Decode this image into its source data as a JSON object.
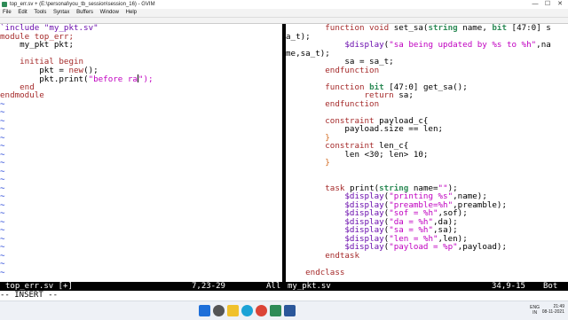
{
  "window": {
    "title": "top_err.sv + (E:\\personal\\you_tb_session\\session_16) - GVIM",
    "controls": [
      "—",
      "☐",
      "✕"
    ]
  },
  "menu": [
    "File",
    "Edit",
    "Tools",
    "Syntax",
    "Buffers",
    "Window",
    "Help"
  ],
  "left_pane": {
    "lines": [
      [
        {
          "t": "`include \"my_pkt.sv\"",
          "c": "k-purple"
        }
      ],
      [
        {
          "t": "module top_err;",
          "c": "k-brown"
        }
      ],
      [
        {
          "t": "    my_pkt pkt;",
          "c": ""
        }
      ],
      [
        {
          "t": "",
          "c": ""
        }
      ],
      [
        {
          "t": "    ",
          "c": ""
        },
        {
          "t": "initial begin",
          "c": "k-brown"
        }
      ],
      [
        {
          "t": "        pkt = ",
          "c": ""
        },
        {
          "t": "new",
          "c": "k-brown"
        },
        {
          "t": "();",
          "c": ""
        }
      ],
      [
        {
          "t": "        pkt.print(",
          "c": ""
        },
        {
          "t": "\"before ra",
          "c": "k-magenta"
        },
        {
          "t": "CURSOR",
          "c": ""
        },
        {
          "t": "\");",
          "c": "k-magenta"
        }
      ],
      [
        {
          "t": "    ",
          "c": ""
        },
        {
          "t": "end",
          "c": "k-brown"
        }
      ],
      [
        {
          "t": "endmodule",
          "c": "k-brown"
        }
      ]
    ],
    "tilde_count": 21
  },
  "right_pane": {
    "lines": [
      [
        {
          "t": "        ",
          "c": ""
        },
        {
          "t": "function void",
          "c": "k-brown"
        },
        {
          "t": " set_sa(",
          "c": ""
        },
        {
          "t": "string",
          "c": "k-green"
        },
        {
          "t": " name, ",
          "c": ""
        },
        {
          "t": "bit",
          "c": "k-green"
        },
        {
          "t": " [47:0] s",
          "c": ""
        }
      ],
      [
        {
          "t": "a_t);",
          "c": ""
        }
      ],
      [
        {
          "t": "            ",
          "c": ""
        },
        {
          "t": "$display",
          "c": "k-purple"
        },
        {
          "t": "(",
          "c": ""
        },
        {
          "t": "\"sa being updated by %s to %h\"",
          "c": "k-magenta"
        },
        {
          "t": ",na",
          "c": ""
        }
      ],
      [
        {
          "t": "me,sa_t);",
          "c": ""
        }
      ],
      [
        {
          "t": "            sa = sa_t;",
          "c": ""
        }
      ],
      [
        {
          "t": "        ",
          "c": ""
        },
        {
          "t": "endfunction",
          "c": "k-brown"
        }
      ],
      [
        {
          "t": "",
          "c": ""
        }
      ],
      [
        {
          "t": "        ",
          "c": ""
        },
        {
          "t": "function",
          "c": "k-brown"
        },
        {
          "t": " ",
          "c": ""
        },
        {
          "t": "bit",
          "c": "k-green"
        },
        {
          "t": " [47:0] get_sa();",
          "c": ""
        }
      ],
      [
        {
          "t": "                ",
          "c": ""
        },
        {
          "t": "return",
          "c": "k-brown"
        },
        {
          "t": " sa;",
          "c": ""
        }
      ],
      [
        {
          "t": "        ",
          "c": ""
        },
        {
          "t": "endfunction",
          "c": "k-brown"
        }
      ],
      [
        {
          "t": "",
          "c": ""
        }
      ],
      [
        {
          "t": "        ",
          "c": ""
        },
        {
          "t": "constraint",
          "c": "k-brown"
        },
        {
          "t": " payload_c{",
          "c": ""
        }
      ],
      [
        {
          "t": "            payload.size == len;",
          "c": ""
        }
      ],
      [
        {
          "t": "        }",
          "c": "k-orange"
        }
      ],
      [
        {
          "t": "        ",
          "c": ""
        },
        {
          "t": "constraint",
          "c": "k-brown"
        },
        {
          "t": " len_c{",
          "c": ""
        }
      ],
      [
        {
          "t": "            len <30; len> 10;",
          "c": ""
        }
      ],
      [
        {
          "t": "        }",
          "c": "k-orange"
        }
      ],
      [
        {
          "t": "",
          "c": ""
        }
      ],
      [
        {
          "t": "",
          "c": ""
        }
      ],
      [
        {
          "t": "        ",
          "c": ""
        },
        {
          "t": "task",
          "c": "k-brown"
        },
        {
          "t": " print(",
          "c": ""
        },
        {
          "t": "string",
          "c": "k-green"
        },
        {
          "t": " name=",
          "c": ""
        },
        {
          "t": "\"\"",
          "c": "k-magenta"
        },
        {
          "t": ");",
          "c": ""
        }
      ],
      [
        {
          "t": "            ",
          "c": ""
        },
        {
          "t": "$display",
          "c": "k-purple"
        },
        {
          "t": "(",
          "c": ""
        },
        {
          "t": "\"printing %s\"",
          "c": "k-magenta"
        },
        {
          "t": ",name);",
          "c": ""
        }
      ],
      [
        {
          "t": "            ",
          "c": ""
        },
        {
          "t": "$display",
          "c": "k-purple"
        },
        {
          "t": "(",
          "c": ""
        },
        {
          "t": "\"preamble=%h\"",
          "c": "k-magenta"
        },
        {
          "t": ",preamble);",
          "c": ""
        }
      ],
      [
        {
          "t": "            ",
          "c": ""
        },
        {
          "t": "$display",
          "c": "k-purple"
        },
        {
          "t": "(",
          "c": ""
        },
        {
          "t": "\"sof = %h\"",
          "c": "k-magenta"
        },
        {
          "t": ",sof);",
          "c": ""
        }
      ],
      [
        {
          "t": "            ",
          "c": ""
        },
        {
          "t": "$display",
          "c": "k-purple"
        },
        {
          "t": "(",
          "c": ""
        },
        {
          "t": "\"da = %h\"",
          "c": "k-magenta"
        },
        {
          "t": ",da);",
          "c": ""
        }
      ],
      [
        {
          "t": "            ",
          "c": ""
        },
        {
          "t": "$display",
          "c": "k-purple"
        },
        {
          "t": "(",
          "c": ""
        },
        {
          "t": "\"sa = %h\"",
          "c": "k-magenta"
        },
        {
          "t": ",sa);",
          "c": ""
        }
      ],
      [
        {
          "t": "            ",
          "c": ""
        },
        {
          "t": "$display",
          "c": "k-purple"
        },
        {
          "t": "(",
          "c": ""
        },
        {
          "t": "\"len = %h\"",
          "c": "k-magenta"
        },
        {
          "t": ",len);",
          "c": ""
        }
      ],
      [
        {
          "t": "            ",
          "c": ""
        },
        {
          "t": "$display",
          "c": "k-purple"
        },
        {
          "t": "(",
          "c": ""
        },
        {
          "t": "\"payload = %p\"",
          "c": "k-magenta"
        },
        {
          "t": ",payload);",
          "c": ""
        }
      ],
      [
        {
          "t": "        ",
          "c": ""
        },
        {
          "t": "endtask",
          "c": "k-brown"
        }
      ],
      [
        {
          "t": "",
          "c": ""
        }
      ],
      [
        {
          "t": "    ",
          "c": ""
        },
        {
          "t": "endclass",
          "c": "k-brown"
        }
      ]
    ]
  },
  "status_left": {
    "file": "top_err.sv [+]",
    "pos": "7,23-29",
    "scroll": "All"
  },
  "status_right": {
    "file": "my_pkt.sv",
    "pos": "34,9-15",
    "scroll": "Bot"
  },
  "cmdline": "-- INSERT --",
  "taskbar": {
    "lang_top": "ENG",
    "lang_bottom": "IN",
    "time": "21:49",
    "date": "08-11-2021"
  },
  "colors": {
    "keyword": "#a52a2a",
    "type": "#2e8b57",
    "system_task": "#6a0dad",
    "string": "#c000c0",
    "tilde": "#1a3bd6"
  }
}
